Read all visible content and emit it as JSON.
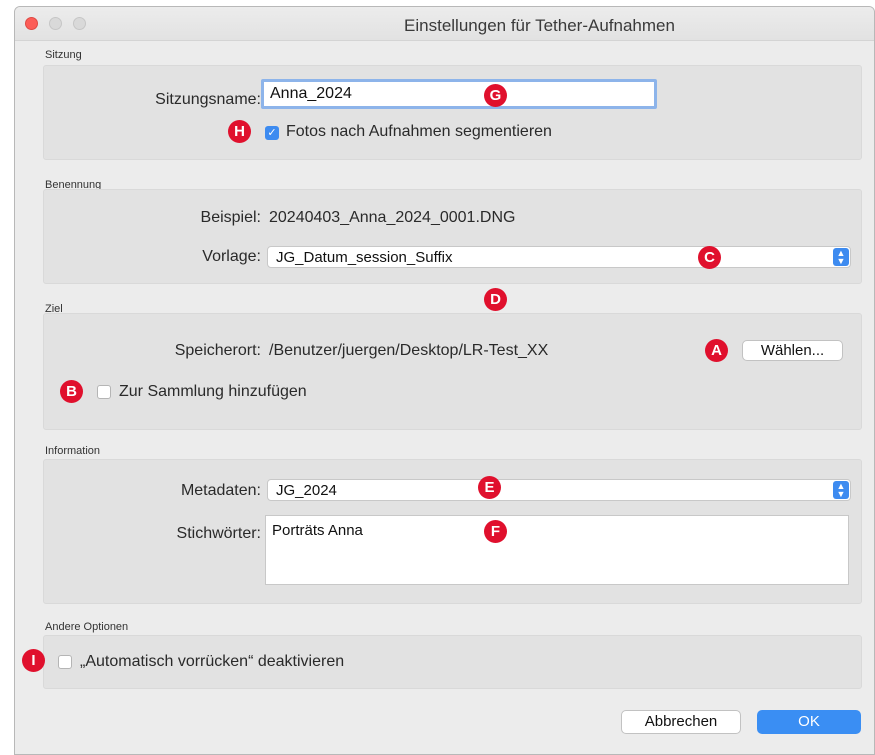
{
  "window": {
    "title": "Einstellungen für Tether-Aufnahmen"
  },
  "sitzung": {
    "section_label": "Sitzung",
    "name_label": "Sitzungsname:",
    "name_value": "Anna_2024",
    "segment_checkbox_label": "Fotos nach Aufnahmen segmentieren",
    "segment_checked": true
  },
  "benennung": {
    "section_label": "Benennung",
    "example_label": "Beispiel:",
    "example_value": "20240403_Anna_2024_0001.DNG",
    "template_label": "Vorlage:",
    "template_value": "JG_Datum_session_Suffix"
  },
  "ziel": {
    "section_label": "Ziel",
    "location_label": "Speicherort:",
    "location_value": "/Benutzer/juergen/Desktop/LR-Test_XX",
    "choose_button": "Wählen...",
    "collection_checkbox_label": "Zur Sammlung hinzufügen",
    "collection_checked": false
  },
  "information": {
    "section_label": "Information",
    "metadata_label": "Metadaten:",
    "metadata_value": "JG_2024",
    "keywords_label": "Stichwörter:",
    "keywords_value": "Porträts Anna"
  },
  "andere": {
    "section_label": "Andere Optionen",
    "advance_checkbox_label": "„Automatisch vorrücken“ deaktivieren",
    "advance_checked": false
  },
  "buttons": {
    "cancel": "Abbrechen",
    "ok": "OK"
  },
  "markers": {
    "a": "A",
    "b": "B",
    "c": "C",
    "d": "D",
    "e": "E",
    "f": "F",
    "g": "G",
    "h": "H",
    "i": "I"
  },
  "colors": {
    "accent": "#3a8ef3",
    "marker": "#e0102d",
    "close": "#fc5d57"
  }
}
